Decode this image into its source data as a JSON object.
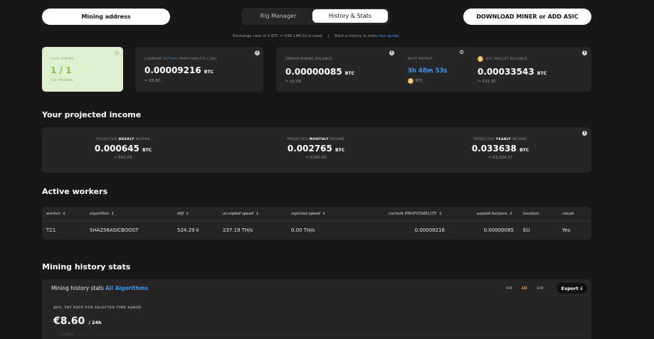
{
  "header": {
    "mining_address": "Mining address",
    "tabs": [
      {
        "label": "Rig Manager",
        "active": false
      },
      {
        "label": "History & Stats",
        "active": true
      }
    ],
    "download_button": "DOWNLOAD MINER or ADD ASIC",
    "exchange_note": "Exchange rate of 1 BTC ≈ €96,148.02 is used.",
    "separator": "|",
    "tour_text": "Start a history & stats",
    "tour_link": "tour guide."
  },
  "summary": {
    "rigs": {
      "label": "RIGS MINING",
      "value": "1 / 1",
      "sub": "1/1 devices"
    },
    "profitability": {
      "label_pre": "CURRENT",
      "label_accent": "ACTUAL",
      "label_post": "PROFITABILITY / 24H",
      "value": "0.00009216",
      "unit": "BTC",
      "sub": "≈ €8.86"
    },
    "unpaid": {
      "label": "UNPAID MINING BALANCE",
      "value": "0.00000085",
      "unit": "BTC",
      "sub": "≈ €0.08"
    },
    "payout": {
      "label": "NEXT PAYOUT:",
      "value": "3h 48m 53s",
      "currency": "BTC"
    },
    "wallet": {
      "label": "BTC WALLET BALANCE",
      "value": "0.00033543",
      "unit": "BTC",
      "sub": "≈ €32.25"
    }
  },
  "projected": {
    "title": "Your projected income",
    "weekly": {
      "pre": "PROJECTED",
      "bold": "WEEKLY",
      "post": "INCOME",
      "value": "0.000645",
      "unit": "BTC",
      "sub": "≈ €62.03"
    },
    "monthly": {
      "pre": "PROJECTED",
      "bold": "MONTHLY",
      "post": "INCOME",
      "value": "0.002765",
      "unit": "BTC",
      "sub": "≈ €265.83"
    },
    "yearly": {
      "pre": "PROJECTED",
      "bold": "YEARLY",
      "post": "INCOME",
      "value": "0.033638",
      "unit": "BTC",
      "sub": "≈ €3,234.27"
    }
  },
  "workers": {
    "title": "Active workers",
    "columns": [
      "worker",
      "algorithm",
      "diff",
      "accepted speed",
      "rejected speed",
      "current PROFITABILITY",
      "unpaid balance",
      "location",
      "xnsub"
    ],
    "rows": [
      [
        "T21",
        "SHA256ASICBOOST",
        "524.29 k",
        "237.19 TH/s",
        "0.00 TH/s",
        "0.00009216",
        "0.00000085",
        "EU",
        "Yes"
      ]
    ]
  },
  "history": {
    "title": "Mining history stats",
    "card_title": "Mining history stats",
    "algo_link": "All Algorithms",
    "ranges": [
      {
        "label": "6H",
        "active": false
      },
      {
        "label": "1D",
        "active": true
      },
      {
        "label": "1W",
        "active": false
      }
    ],
    "export_label": "Export",
    "avg_label": "AVG. PAY RATE FOR SELECTED TIME RANGE",
    "avg_value": "€8.60",
    "avg_unit": "/ 24h",
    "axis_tick": "0.0002"
  },
  "colors": {
    "accent_blue": "#3b97f2",
    "btc_orange": "#f39c21",
    "rigs_green": "#7cc142",
    "rigs_bg": "#dff0d0",
    "active_range": "#f39c21"
  }
}
